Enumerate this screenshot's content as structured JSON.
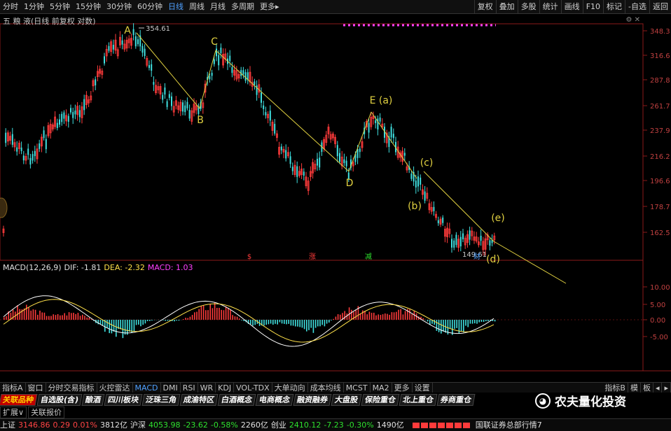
{
  "toolbar": {
    "periods": [
      "分时",
      "1分钟",
      "5分钟",
      "15分钟",
      "30分钟",
      "60分钟",
      "日线",
      "周线",
      "月线",
      "多周期",
      "更多▸"
    ],
    "active_period": "日线",
    "right_buttons": [
      "复权",
      "叠加",
      "多股",
      "统计",
      "画线",
      "F10",
      "标记",
      "-自选",
      "返回"
    ]
  },
  "stock_title": "五 粮 液(日线 前复权 对数)",
  "price_axis": [
    "348.3",
    "316.6",
    "287.8",
    "261.7",
    "237.9",
    "216.2",
    "196.6",
    "178.7",
    "162.5"
  ],
  "macd_axis": [
    "10.00",
    "5.00",
    "0.00",
    "-5.00"
  ],
  "annotations": {
    "high_price": "354.61",
    "low_price": "149.61",
    "labels": [
      "A",
      "B",
      "C",
      "D",
      "E (a)",
      "(b)",
      "(c)",
      "(d)",
      "(e)"
    ],
    "markers": [
      "$",
      "涨",
      "减",
      "财"
    ]
  },
  "macd_legend": {
    "name": "MACD(12,26,9)",
    "dif": "DIF: -1.81",
    "dea": "DEA: -2.32",
    "macd": "MACD: 1.03"
  },
  "time_axis": [
    "2020年",
    "10",
    "11",
    "12",
    "1",
    "2",
    "3",
    "4",
    "5",
    "6",
    "7",
    "8",
    "9",
    "10",
    "11",
    "12",
    "1",
    "2",
    "3",
    "4",
    "5"
  ],
  "time_axis_right": "日线",
  "indicator_tabs": [
    "指标A",
    "窗口",
    "分时交易指标",
    "火控雷达",
    "MACD",
    "DMI",
    "RSI",
    "WR",
    "KDJ",
    "VOL-TDX",
    "大单动向",
    "成本均线",
    "MCST",
    "MA2",
    "更多",
    "设置"
  ],
  "active_indicator": "MACD",
  "indicator_right": [
    "指标B",
    "模",
    "板",
    "◂",
    "▸"
  ],
  "sector_tabs": [
    "关联品种",
    "自选股(含)",
    "酿酒",
    "四川板块",
    "泛珠三角",
    "成渝特区",
    "白酒概念",
    "电商概念",
    "融资融券",
    "大盘股",
    "保险重仓",
    "北上重仓",
    "券商重仓"
  ],
  "ext_row": [
    "扩展∨",
    "关联报价"
  ],
  "status": {
    "sh_name": "上证",
    "sh_price": "3146.86",
    "sh_chg": "0.29",
    "sh_pct": "0.01%",
    "sh_vol": "3812亿",
    "hs_name": "沪深",
    "hs_price": "4053.98",
    "hs_chg": "-23.62",
    "hs_pct": "-0.58%",
    "hs_vol": "2260亿",
    "cy_name": "创业",
    "cy_price": "2410.12",
    "cy_chg": "-7.23",
    "cy_pct": "-0.30%",
    "cy_vol": "1490亿",
    "broker": "国联证券总部行情7"
  },
  "watermark": "农夫量化投资",
  "colors": {
    "up": "#ff3b3b",
    "down": "#40e0e0",
    "dif": "#ffffff",
    "dea": "#ffe14a",
    "wave": "#e0d040",
    "macd": "#ff40ff"
  }
}
